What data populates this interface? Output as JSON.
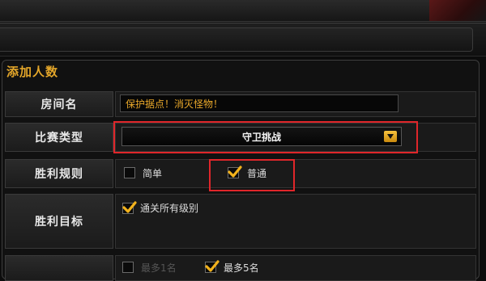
{
  "panel": {
    "title": "添加人数"
  },
  "room_name": {
    "label": "房间名",
    "value": "保护据点！消灭怪物！"
  },
  "match_type": {
    "label": "比赛类型",
    "selected": "守卫挑战"
  },
  "win_rule": {
    "label": "胜利规则",
    "options": [
      {
        "label": "简单",
        "checked": false
      },
      {
        "label": "普通",
        "checked": true
      }
    ]
  },
  "win_goal": {
    "label": "胜利目标",
    "options": [
      {
        "label": "通关所有级别",
        "checked": true
      }
    ]
  },
  "players": {
    "options": [
      {
        "label": "最多1名",
        "checked": false
      },
      {
        "label": "最多5名",
        "checked": true
      }
    ]
  },
  "colors": {
    "accent": "#e8a72a",
    "highlight": "#e0262a",
    "checkbox_tick": "#f2b21c"
  }
}
